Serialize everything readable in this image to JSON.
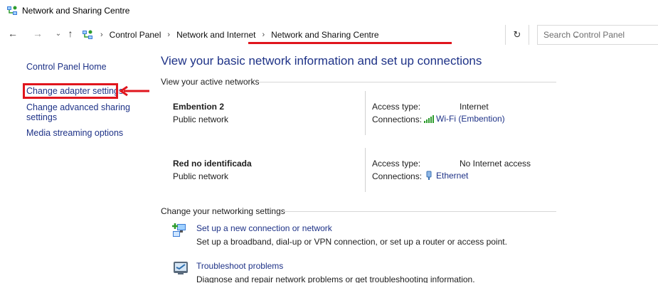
{
  "window": {
    "title": "Network and Sharing Centre",
    "app_icon": "network-sharing-icon"
  },
  "nav": {
    "back": "←",
    "forward": "→",
    "recent": "⌄",
    "up": "↑"
  },
  "address": {
    "crumbs": [
      "Control Panel",
      "Network and Internet",
      "Network and Sharing Centre"
    ],
    "separator": "›",
    "dropdown": "⌄",
    "refresh": "↻",
    "search_placeholder": "Search Control Panel"
  },
  "sidebar": {
    "home": "Control Panel Home",
    "links": [
      "Change adapter settings",
      "Change advanced sharing settings",
      "Media streaming options"
    ]
  },
  "main": {
    "title": "View your basic network information and set up connections",
    "active_header": "View your active networks",
    "networks": [
      {
        "name": "Embention 2",
        "type": "Public network",
        "access_label": "Access type:",
        "access_value": "Internet",
        "connections_label": "Connections:",
        "connection_name": "Wi-Fi (Embention)",
        "connection_icon": "wifi-signal-icon"
      },
      {
        "name": "Red no identificada",
        "type": "Public network",
        "access_label": "Access type:",
        "access_value": "No Internet access",
        "connections_label": "Connections:",
        "connection_name": "Ethernet",
        "connection_icon": "ethernet-icon"
      }
    ],
    "settings_header": "Change your networking settings",
    "tasks": [
      {
        "link": "Set up a new connection or network",
        "description": "Set up a broadband, dial-up or VPN connection, or set up a router or access point.",
        "icon": "new-connection-icon"
      },
      {
        "link": "Troubleshoot problems",
        "description": "Diagnose and repair network problems or get troubleshooting information.",
        "icon": "troubleshoot-icon"
      }
    ]
  },
  "annotations": {
    "highlight_color": "#e0151d"
  },
  "colors": {
    "link": "#1e3287",
    "text": "#1e1e1e"
  }
}
